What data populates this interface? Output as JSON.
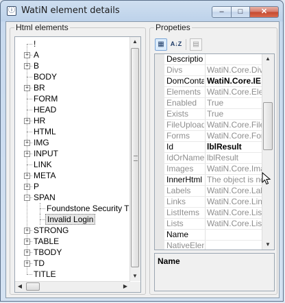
{
  "window": {
    "title": "WatiN element details",
    "min_glyph": "‒",
    "max_glyph": "□",
    "close_glyph": "✕"
  },
  "left_panel": {
    "label": "Html elements",
    "tree": [
      {
        "label": "!",
        "expandable": false
      },
      {
        "label": "A",
        "expandable": true
      },
      {
        "label": "B",
        "expandable": true
      },
      {
        "label": "BODY",
        "expandable": false
      },
      {
        "label": "BR",
        "expandable": true
      },
      {
        "label": "FORM",
        "expandable": false
      },
      {
        "label": "HEAD",
        "expandable": false
      },
      {
        "label": "HR",
        "expandable": true
      },
      {
        "label": "HTML",
        "expandable": false
      },
      {
        "label": "IMG",
        "expandable": true
      },
      {
        "label": "INPUT",
        "expandable": true
      },
      {
        "label": "LINK",
        "expandable": false
      },
      {
        "label": "META",
        "expandable": true
      },
      {
        "label": "P",
        "expandable": true
      },
      {
        "label": "SPAN",
        "expandable": true,
        "expanded": true
      },
      {
        "label": "Foundstone Security Trainin",
        "child": true
      },
      {
        "label": "Invalid Login",
        "child": true,
        "selected": true
      },
      {
        "label": "STRONG",
        "expandable": true
      },
      {
        "label": "TABLE",
        "expandable": true
      },
      {
        "label": "TBODY",
        "expandable": true
      },
      {
        "label": "TD",
        "expandable": true
      },
      {
        "label": "TITLE",
        "expandable": false
      }
    ]
  },
  "right_panel": {
    "label": "Propeties",
    "toolbar": {
      "categorized_glyph": "▦",
      "sort_glyph": "A↓Z",
      "pages_glyph": "▤"
    },
    "properties": [
      {
        "name": "Descriptio",
        "value": "",
        "style": "edit"
      },
      {
        "name": "Divs",
        "value": "WatiN.Core.DivCo",
        "style": "ro"
      },
      {
        "name": "DomContai",
        "value": "WatiN.Core.IE",
        "style": "ro-bold"
      },
      {
        "name": "Elements",
        "value": "WatiN.Core.Eleme",
        "style": "ro"
      },
      {
        "name": "Enabled",
        "value": "True",
        "style": "ro"
      },
      {
        "name": "Exists",
        "value": "True",
        "style": "ro"
      },
      {
        "name": "FileUpload",
        "value": "WatiN.Core.FileUp",
        "style": "ro"
      },
      {
        "name": "Forms",
        "value": "WatiN.Core.FormC",
        "style": "ro"
      },
      {
        "name": "Id",
        "value": "lblResult",
        "style": "bold"
      },
      {
        "name": "IdOrName",
        "value": "lblResult",
        "style": "ro"
      },
      {
        "name": "Images",
        "value": "WatiN.Core.Image",
        "style": "ro"
      },
      {
        "name": "InnerHtml",
        "value": "The object is not v",
        "style": "edit-grey"
      },
      {
        "name": "Labels",
        "value": "WatiN.Core.Label",
        "style": "ro"
      },
      {
        "name": "Links",
        "value": "WatiN.Core.LinkC",
        "style": "ro"
      },
      {
        "name": "ListItems",
        "value": "WatiN.Core.ListIte",
        "style": "ro"
      },
      {
        "name": "Lists",
        "value": "WatiN.Core.ListCo",
        "style": "ro"
      },
      {
        "name": "Name",
        "value": "",
        "style": "edit"
      },
      {
        "name": "NativeElen",
        "value": "",
        "style": "ro"
      }
    ],
    "description": {
      "title": "Name",
      "text": ""
    }
  }
}
